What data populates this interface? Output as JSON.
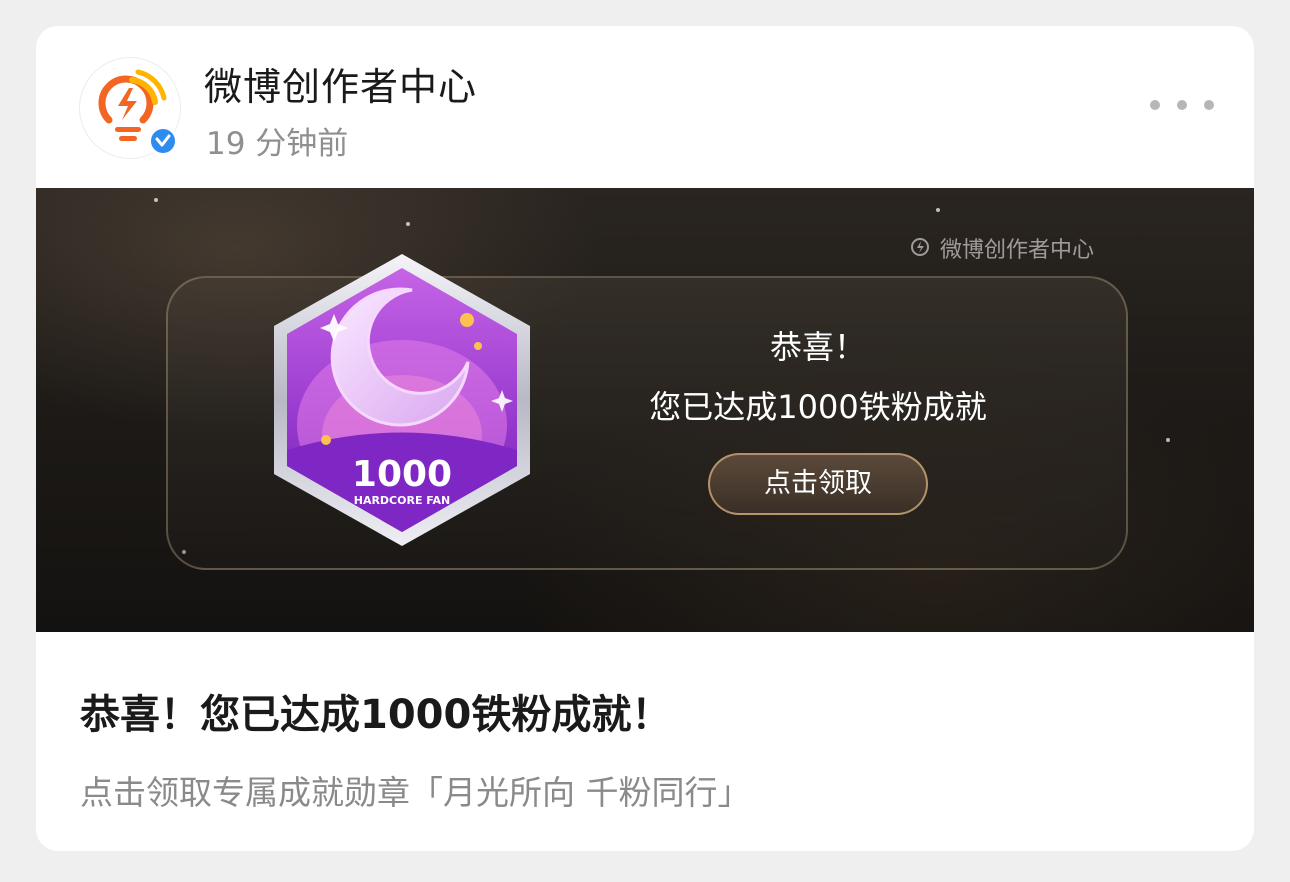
{
  "post": {
    "author": "微博创作者中心",
    "time": "19 分钟前",
    "title": "恭喜！您已达成1000铁粉成就！",
    "description": "点击领取专属成就勋章「月光所向 千粉同行」"
  },
  "banner": {
    "watermark": "微博创作者中心",
    "heading": "恭喜！",
    "subheading": "您已达成1000铁粉成就",
    "button_label": "点击领取",
    "badge_number": "1000",
    "badge_caption": "HARDCORE FAN"
  },
  "icons": {
    "avatar": "lightbulb-bolt-logo-icon",
    "verified": "verified-check-icon",
    "more": "more-dots-icon"
  },
  "colors": {
    "accent_orange": "#f26522",
    "verified_blue": "#2d8cf0",
    "badge_purple": "#9b3fd0",
    "button_border": "#d6b080"
  }
}
